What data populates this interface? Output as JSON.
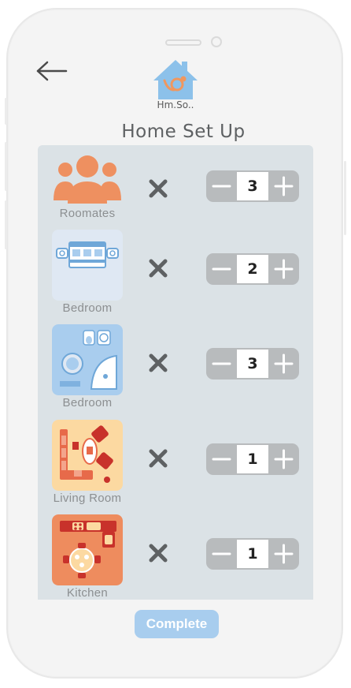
{
  "app": {
    "logo_text": "Hm.So..",
    "title": "Home Set Up"
  },
  "rooms": [
    {
      "label": "Roomates",
      "icon": "people-icon",
      "count": "3"
    },
    {
      "label": "Bedroom",
      "icon": "bedroom-floorplan-icon",
      "count": "2"
    },
    {
      "label": "Bedroom",
      "icon": "bathroom-floorplan-icon",
      "count": "3"
    },
    {
      "label": "Living Room",
      "icon": "living-room-floorplan-icon",
      "count": "1"
    },
    {
      "label": "Kitchen",
      "icon": "kitchen-floorplan-icon",
      "count": "1"
    }
  ],
  "actions": {
    "complete_label": "Complete"
  },
  "colors": {
    "accent": "#a8cdee",
    "logo_blue": "#8cc1ea",
    "logo_orange": "#f0975f",
    "panel": "#dbe2e6",
    "stepper": "#b8bbbd"
  }
}
